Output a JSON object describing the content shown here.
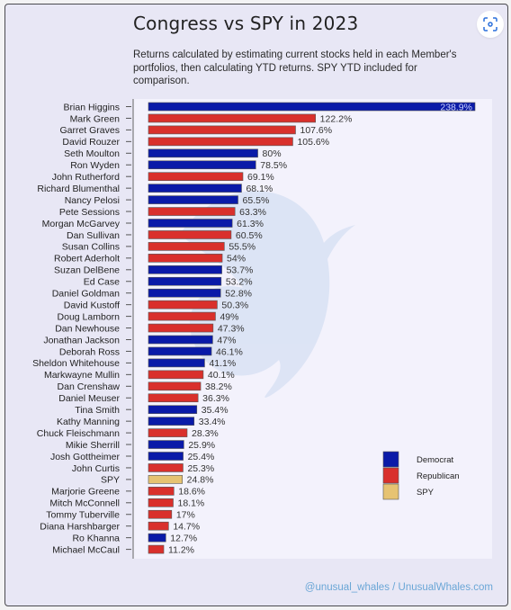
{
  "header": {
    "title": "Congress vs SPY in 2023",
    "subtitle": "Returns calculated by estimating current stocks held in each Member's portfolios, then calculating YTD returns. SPY YTD included for comparison.",
    "scan_button_icon": "scan-icon"
  },
  "footer": {
    "credit": "@unusual_whales / UnusualWhales.com"
  },
  "colors": {
    "Democrat": "#0a1aa8",
    "Republican": "#d9302c",
    "SPY": "#e6c372"
  },
  "chart_data": {
    "type": "bar",
    "orientation": "horizontal",
    "title": "Congress vs SPY in 2023",
    "xlabel": "",
    "ylabel": "",
    "value_suffix": "%",
    "xlim": [
      0,
      238.9
    ],
    "grid": false,
    "legend": {
      "placement": "bottom-right",
      "entries": [
        "Democrat",
        "Republican",
        "SPY"
      ]
    },
    "categories": [
      "Brian Higgins",
      "Mark Green",
      "Garret Graves",
      "David Rouzer",
      "Seth Moulton",
      "Ron Wyden",
      "John Rutherford",
      "Richard Blumenthal",
      "Nancy Pelosi",
      "Pete Sessions",
      "Morgan McGarvey",
      "Dan Sullivan",
      "Susan Collins",
      "Robert Aderholt",
      "Suzan DelBene",
      "Ed Case",
      "Daniel Goldman",
      "David Kustoff",
      "Doug Lamborn",
      "Dan Newhouse",
      "Jonathan Jackson",
      "Deborah Ross",
      "Sheldon Whitehouse",
      "Markwayne Mullin",
      "Dan Crenshaw",
      "Daniel Meuser",
      "Tina Smith",
      "Kathy Manning",
      "Chuck Fleischmann",
      "Mikie Sherrill",
      "Josh Gottheimer",
      "John Curtis",
      "SPY",
      "Marjorie Greene",
      "Mitch McConnell",
      "Tommy Tuberville",
      "Diana Harshbarger",
      "Ro Khanna",
      "Michael McCaul"
    ],
    "values": [
      238.9,
      122.2,
      107.6,
      105.6,
      80,
      78.5,
      69.1,
      68.1,
      65.5,
      63.3,
      61.3,
      60.5,
      55.5,
      54,
      53.7,
      53.2,
      52.8,
      50.3,
      49,
      47.3,
      47,
      46.1,
      41.1,
      40.1,
      38.2,
      36.3,
      35.4,
      33.4,
      28.3,
      25.9,
      25.4,
      25.3,
      24.8,
      18.6,
      18.1,
      17,
      14.7,
      12.7,
      11.2
    ],
    "labels": [
      "238.9%",
      "122.2%",
      "107.6%",
      "105.6%",
      "80%",
      "78.5%",
      "69.1%",
      "68.1%",
      "65.5%",
      "63.3%",
      "61.3%",
      "60.5%",
      "55.5%",
      "54%",
      "53.7%",
      "53.2%",
      "52.8%",
      "50.3%",
      "49%",
      "47.3%",
      "47%",
      "46.1%",
      "41.1%",
      "40.1%",
      "38.2%",
      "36.3%",
      "35.4%",
      "33.4%",
      "28.3%",
      "25.9%",
      "25.4%",
      "25.3%",
      "24.8%",
      "18.6%",
      "18.1%",
      "17%",
      "14.7%",
      "12.7%",
      "11.2%"
    ],
    "groups": [
      "Democrat",
      "Republican",
      "Republican",
      "Republican",
      "Democrat",
      "Democrat",
      "Republican",
      "Democrat",
      "Democrat",
      "Republican",
      "Democrat",
      "Republican",
      "Republican",
      "Republican",
      "Democrat",
      "Democrat",
      "Democrat",
      "Republican",
      "Republican",
      "Republican",
      "Democrat",
      "Democrat",
      "Democrat",
      "Republican",
      "Republican",
      "Republican",
      "Democrat",
      "Democrat",
      "Republican",
      "Democrat",
      "Democrat",
      "Republican",
      "SPY",
      "Republican",
      "Republican",
      "Republican",
      "Republican",
      "Democrat",
      "Republican"
    ],
    "series": [
      {
        "name": "Democrat",
        "color": "#0a1aa8"
      },
      {
        "name": "Republican",
        "color": "#d9302c"
      },
      {
        "name": "SPY",
        "color": "#e6c372"
      }
    ]
  }
}
